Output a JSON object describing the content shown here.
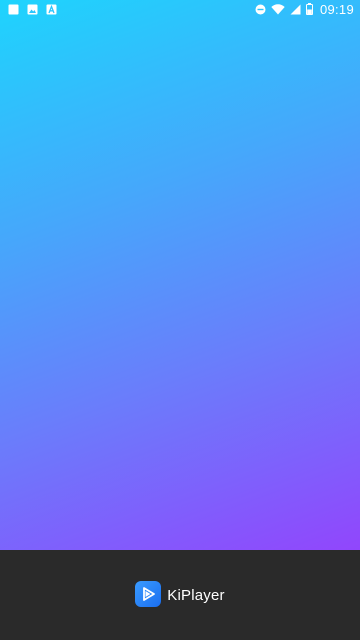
{
  "status_bar": {
    "time": "09:19",
    "left_icons": [
      "notification-square-icon",
      "image-icon",
      "app-a-icon"
    ],
    "right_icons": [
      "do-not-disturb-icon",
      "wifi-icon",
      "signal-icon",
      "battery-icon"
    ],
    "battery_level": 0.5
  },
  "splash": {
    "gradient_start": "#1ed4fd",
    "gradient_end": "#9146fc"
  },
  "branding": {
    "app_name": "KiPlayer",
    "logo_icon": "play-logo-icon",
    "logo_color": "#2b86ff",
    "bar_color": "#2a2a2a"
  }
}
